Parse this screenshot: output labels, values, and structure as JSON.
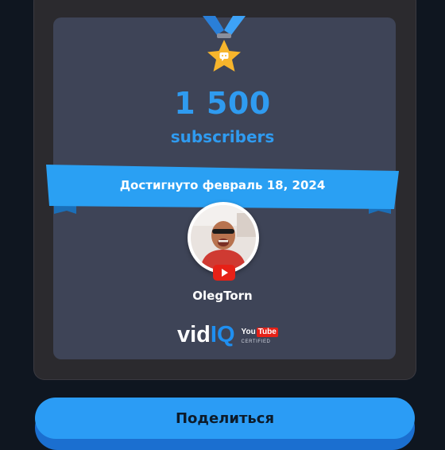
{
  "achievement": {
    "count": "1 500",
    "unit_label": "subscribers",
    "achieved_text": "Достигнуто февраль 18, 2024"
  },
  "channel": {
    "username": "OlegTorn",
    "avatar_icon": "user-avatar-photo",
    "platform_icon": "youtube-icon"
  },
  "branding": {
    "vidiq_part1": "vid",
    "vidiq_part2": "IQ",
    "youtube_you": "You",
    "youtube_tube": "Tube",
    "youtube_certified": "CERTIFIED"
  },
  "actions": {
    "share_label": "Поделиться"
  },
  "colors": {
    "accent_blue": "#2f9bf0",
    "card_bg": "#3e4457",
    "medal_gold": "#f7b52c",
    "youtube_red": "#e62117"
  }
}
